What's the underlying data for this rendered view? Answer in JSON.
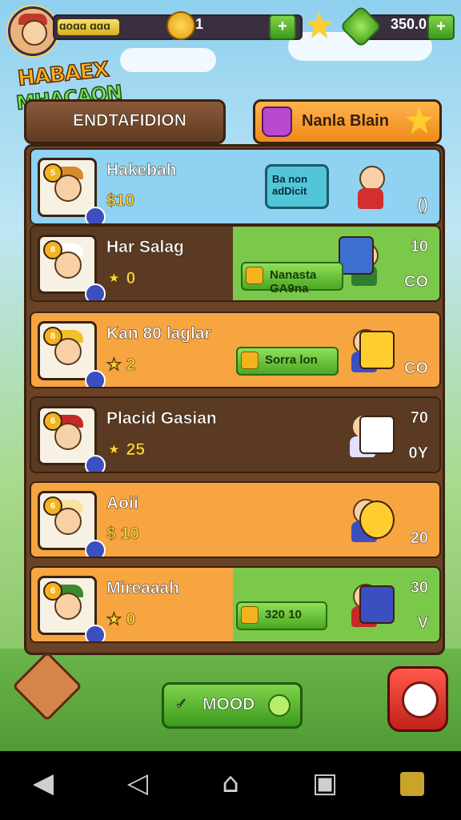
{
  "topbar": {
    "xp_label": "ɑoɑɑ ɑɑɑ",
    "xp_progress": 0.55,
    "coins": "1",
    "coin_plus": "+",
    "gems": "350.0",
    "gem_plus": "+"
  },
  "logo": {
    "line1": "HABAEX",
    "line2": "MHACAON"
  },
  "header": {
    "left_button": "ENDTAFIDION",
    "right_button": "Nanla Blain"
  },
  "rows": [
    {
      "name": "Hakebah",
      "cost": "$10",
      "level": "5",
      "stat1": "",
      "stat2": "()",
      "bubble": "Ba non\nadDicit",
      "bg": "#8fd2f2",
      "left_bg": "#8fd2f2",
      "hat": "#d8892c",
      "char_body": "#d32f2f",
      "item_color": "#53c5d8",
      "button": ""
    },
    {
      "name": "Har Salag",
      "cost": "★ 0",
      "level": "8",
      "stat1": "10",
      "stat2": "CO",
      "bubble": "",
      "bg": "#7bc94a",
      "left_bg": "#5a3a22",
      "hat": "#ffffff",
      "char_body": "#2e7d32",
      "item_color": "#3b6fd0",
      "button": "Nanasta GA9na"
    },
    {
      "name": "Kan 80 laglar",
      "cost": "★ 2",
      "level": "8",
      "stat1": "",
      "stat2": "CO",
      "bubble": "",
      "bg": "#f6a541",
      "left_bg": "#f6a541",
      "hat": "#f2c12e",
      "char_body": "#3b4fc0",
      "item_color": "#ffce2e",
      "button": "Sorra lon"
    },
    {
      "name": "Placid Gasian",
      "cost": "★ 25",
      "level": "6",
      "stat1": "70",
      "stat2": "0Y",
      "bubble": "",
      "bg": "#5a3a22",
      "left_bg": "#5a3a22",
      "hat": "#c62828",
      "char_body": "#e0e0ff",
      "item_color": "#ffffff",
      "button": ""
    },
    {
      "name": "Aoii",
      "cost": "$ 10",
      "level": "6",
      "stat1": "",
      "stat2": "20",
      "bubble": "",
      "bg": "#f6a541",
      "left_bg": "#f6a541",
      "hat": "#f7e3a0",
      "char_body": "#3b4fc0",
      "item_color": "#ffce2e",
      "button": ""
    },
    {
      "name": "Mireaaah",
      "cost": "★ 0",
      "level": "6",
      "stat1": "30",
      "stat2": "V",
      "bubble": "",
      "bg": "#7bc94a",
      "left_bg": "#f6a541",
      "hat": "#3a8a2a",
      "char_body": "#c62828",
      "item_color": "#3b4fc0",
      "button": "320 10"
    }
  ],
  "bottom": {
    "mod_button": "MOOD",
    "mod_check": "✓"
  },
  "navbar": {
    "back": "◀",
    "back_outline": "◁",
    "home": "⌂",
    "recent": "▣"
  }
}
